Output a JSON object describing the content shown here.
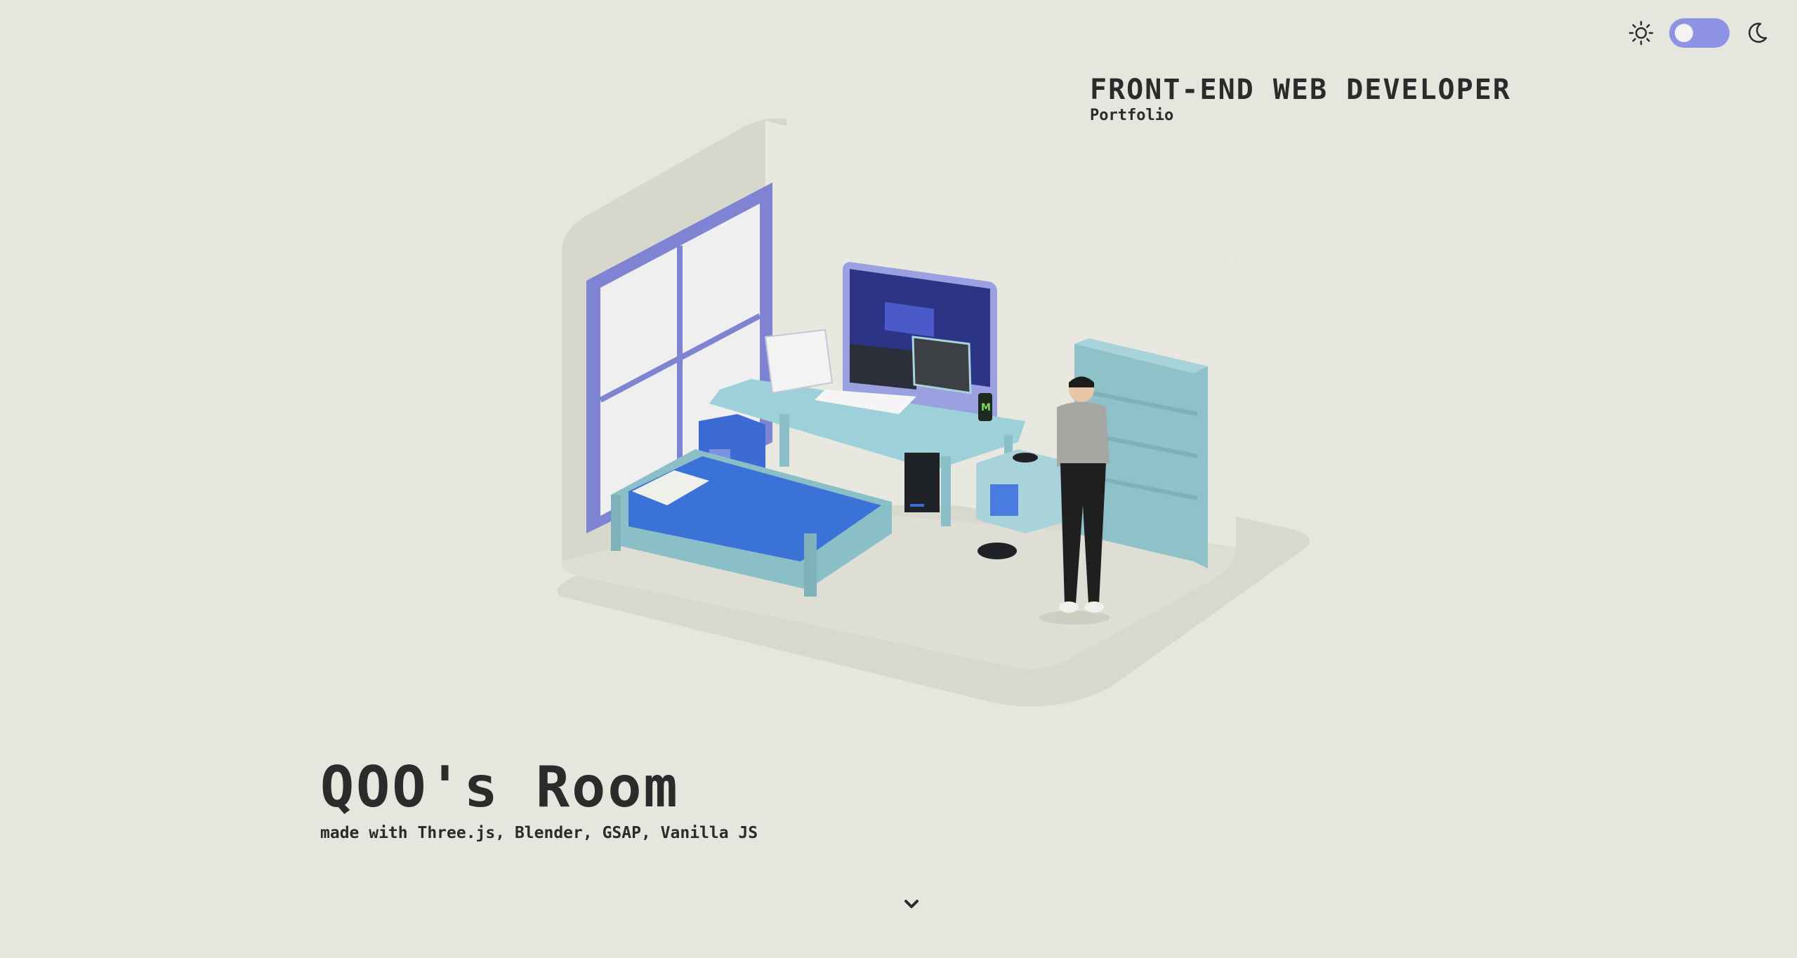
{
  "theme": {
    "background": "#e6e5de",
    "accent": "#8e93e4",
    "text": "#2b2b2b",
    "mode": "light"
  },
  "toggle": {
    "sun_icon": "sun-icon",
    "moon_icon": "moon-icon",
    "switch_state": "light"
  },
  "header": {
    "title": "FRONT-END WEB DEVELOPER",
    "subtitle": "Portfolio"
  },
  "hero": {
    "title": "QOO's Room",
    "subtitle": "made with Three.js, Blender, GSAP, Vanilla JS"
  },
  "scroll": {
    "icon": "chevron-down-icon"
  },
  "scene": {
    "description_icons": [
      "room-scene"
    ],
    "drink_label": "M"
  }
}
